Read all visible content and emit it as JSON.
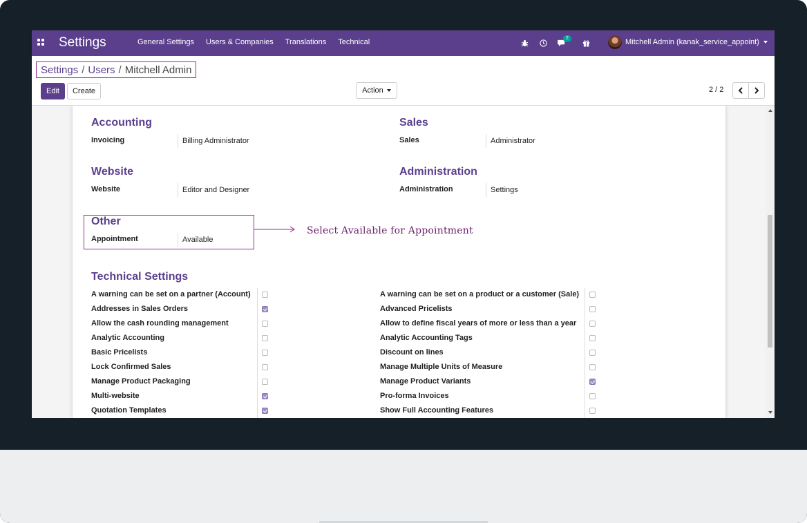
{
  "navbar": {
    "app_title": "Settings",
    "menu": [
      "General Settings",
      "Users & Companies",
      "Translations",
      "Technical"
    ],
    "chat_badge": "2",
    "user_name": "Mitchell Admin (kanak_service_appoint)",
    "icons": [
      "apps-grid-icon",
      "bug-icon",
      "clock-icon",
      "chat-icon",
      "gift-icon"
    ],
    "color": "#5b3f8d"
  },
  "breadcrumb": {
    "items": [
      "Settings",
      "Users"
    ],
    "separator": "/",
    "current": "Mitchell Admin"
  },
  "buttons": {
    "edit": "Edit",
    "create": "Create",
    "action": "Action"
  },
  "pager": {
    "value": "2 / 2"
  },
  "groups": {
    "accounting": {
      "title": "Accounting",
      "label": "Invoicing",
      "value": "Billing Administrator"
    },
    "sales": {
      "title": "Sales",
      "label": "Sales",
      "value": "Administrator"
    },
    "website": {
      "title": "Website",
      "label": "Website",
      "value": "Editor and Designer"
    },
    "administration": {
      "title": "Administration",
      "label": "Administration",
      "value": "Settings"
    },
    "other": {
      "title": "Other",
      "label": "Appointment",
      "value": "Available"
    }
  },
  "annotation": "Select Available for Appointment",
  "technical": {
    "title": "Technical Settings",
    "left": [
      {
        "label": "A warning can be set on a partner (Account)",
        "checked": false
      },
      {
        "label": "Addresses in Sales Orders",
        "checked": true
      },
      {
        "label": "Allow the cash rounding management",
        "checked": false
      },
      {
        "label": "Analytic Accounting",
        "checked": false
      },
      {
        "label": "Basic Pricelists",
        "checked": false
      },
      {
        "label": "Lock Confirmed Sales",
        "checked": false
      },
      {
        "label": "Manage Product Packaging",
        "checked": false
      },
      {
        "label": "Multi-website",
        "checked": true
      },
      {
        "label": "Quotation Templates",
        "checked": true
      }
    ],
    "right": [
      {
        "label": "A warning can be set on a product or a customer (Sale)",
        "checked": false
      },
      {
        "label": "Advanced Pricelists",
        "checked": false
      },
      {
        "label": "Allow to define fiscal years of more or less than a year",
        "checked": false
      },
      {
        "label": "Analytic Accounting Tags",
        "checked": false
      },
      {
        "label": "Discount on lines",
        "checked": false
      },
      {
        "label": "Manage Multiple Units of Measure",
        "checked": false
      },
      {
        "label": "Manage Product Variants",
        "checked": true
      },
      {
        "label": "Pro-forma Invoices",
        "checked": false
      },
      {
        "label": "Show Full Accounting Features",
        "checked": false
      }
    ]
  }
}
